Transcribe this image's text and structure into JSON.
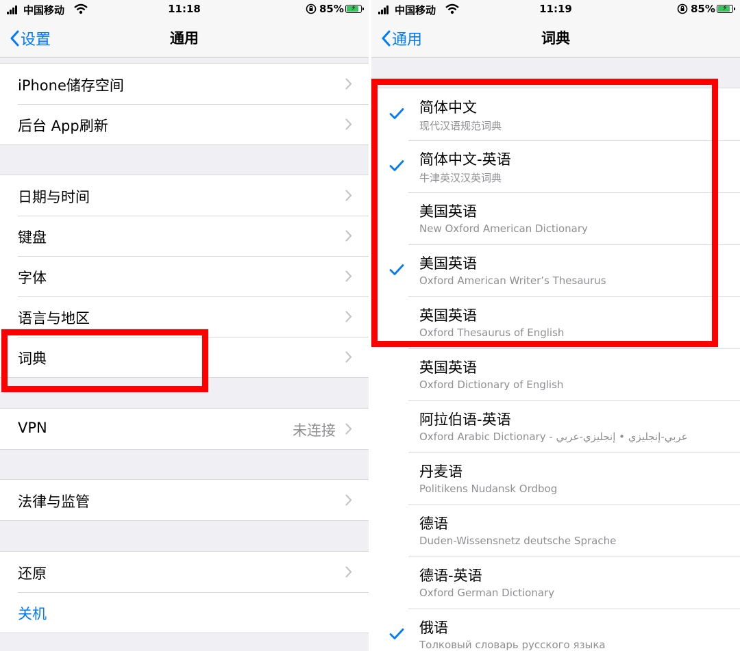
{
  "left_screen": {
    "status": {
      "carrier": "中国移动",
      "time": "11:18",
      "battery": "85%"
    },
    "nav": {
      "back_label": "设置",
      "title": "通用"
    },
    "groups": [
      {
        "items": [
          {
            "label": "iPhone储存空间"
          },
          {
            "label": "后台 App刷新"
          }
        ]
      },
      {
        "items": [
          {
            "label": "日期与时间"
          },
          {
            "label": "键盘"
          },
          {
            "label": "字体"
          },
          {
            "label": "语言与地区"
          },
          {
            "label": "词典"
          }
        ]
      },
      {
        "items": [
          {
            "label": "VPN",
            "value": "未连接"
          }
        ]
      },
      {
        "items": [
          {
            "label": "法律与监管"
          }
        ]
      },
      {
        "items": [
          {
            "label": "还原"
          },
          {
            "label": "关机"
          }
        ]
      }
    ]
  },
  "right_screen": {
    "status": {
      "carrier": "中国移动",
      "time": "11:19",
      "battery": "85%"
    },
    "nav": {
      "back_label": "通用",
      "title": "词典"
    },
    "dictionaries": [
      {
        "name": "简体中文",
        "subtitle": "现代汉语规范词典",
        "checked": true
      },
      {
        "name": "简体中文-英语",
        "subtitle": "牛津英汉汉英词典",
        "checked": true
      },
      {
        "name": "美国英语",
        "subtitle": "New Oxford American Dictionary",
        "checked": false
      },
      {
        "name": "美国英语",
        "subtitle": "Oxford American Writer’s Thesaurus",
        "checked": true
      },
      {
        "name": "英国英语",
        "subtitle": "Oxford Thesaurus of English",
        "checked": false
      },
      {
        "name": "英国英语",
        "subtitle": "Oxford Dictionary of English",
        "checked": false
      },
      {
        "name": "阿拉伯语-英语",
        "subtitle": "Oxford Arabic Dictionary - عربي-إنجليزي • إنجليزي-عربي",
        "checked": false
      },
      {
        "name": "丹麦语",
        "subtitle": "Politikens Nudansk Ordbog",
        "checked": false
      },
      {
        "name": "德语",
        "subtitle": "Duden-Wissensnetz deutsche Sprache",
        "checked": false
      },
      {
        "name": "德语-英语",
        "subtitle": "Oxford German Dictionary",
        "checked": false
      },
      {
        "name": "俄语",
        "subtitle": "Толковый словарь русского языка",
        "checked": true
      }
    ]
  },
  "colors": {
    "accent": "#007aff",
    "highlight": "#ff0000",
    "secondary_text": "#8e8e93",
    "background": "#efeff4"
  },
  "icons": [
    "signal-icon",
    "wifi-icon",
    "rotation-lock-icon",
    "battery-icon",
    "chevron-left-icon",
    "chevron-right-icon",
    "checkmark-icon"
  ]
}
